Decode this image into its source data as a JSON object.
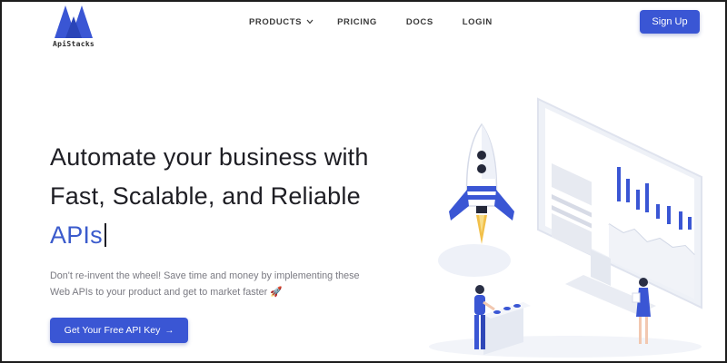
{
  "header": {
    "logo_text": "ApiStacks",
    "nav": {
      "products": "PRODUCTS",
      "pricing": "PRICING",
      "docs": "DOCS",
      "login": "LOGIN"
    },
    "signup_label": "Sign Up"
  },
  "hero": {
    "headline_line1": "Automate your business with",
    "headline_line2": "Fast, Scalable, and Reliable",
    "headline_accent": "APIs",
    "subtext_line1": "Don't re-invent the wheel! Save time and money by implementing these",
    "subtext_line2": "Web APIs to your product and get to market faster 🚀",
    "cta_label": "Get Your Free API Key",
    "cta_arrow": "→"
  },
  "icons": {
    "logo": "apistacks-logo-icon",
    "chevron": "chevron-down-icon",
    "arrow": "arrow-right-icon",
    "illustration": "rocket-dashboard-illustration"
  },
  "colors": {
    "brand": "#3a56d4",
    "accent_text": "#3b5bcc",
    "heading": "#1e1e24",
    "muted": "#7a7a82"
  }
}
